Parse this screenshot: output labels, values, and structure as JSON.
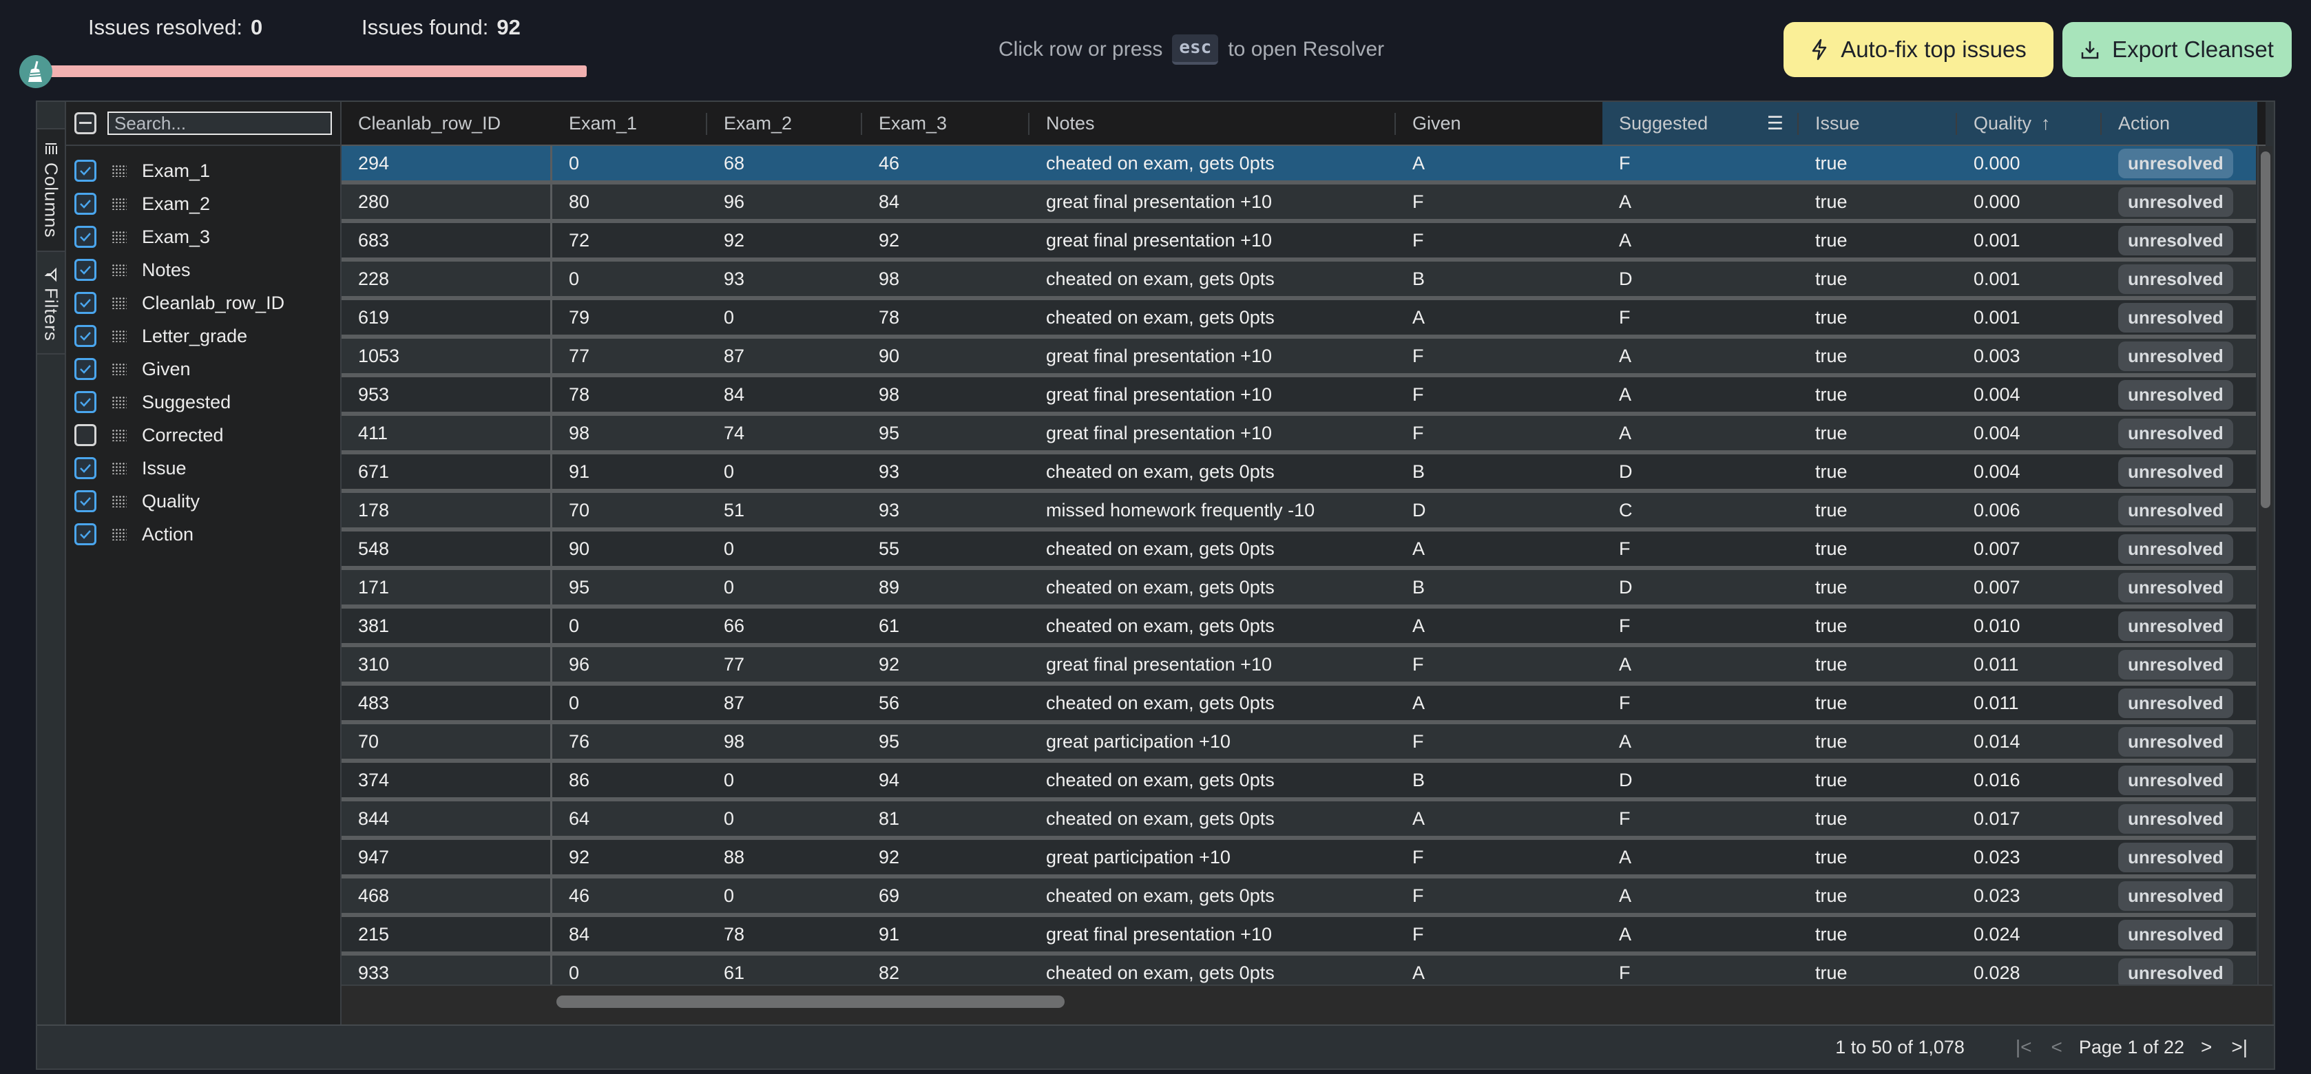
{
  "header": {
    "issues_resolved_label": "Issues resolved:",
    "issues_resolved_value": "0",
    "issues_found_label": "Issues found:",
    "issues_found_value": "92",
    "progress_fraction": 0.0,
    "hint_before": "Click row or press",
    "hint_key": "esc",
    "hint_after": "to open Resolver",
    "autofix_label": "Auto-fix top issues",
    "export_label": "Export Cleanset",
    "colors": {
      "autofix": "#faef97",
      "export": "#a8e4bb",
      "progress_bg": "#f2b1b1",
      "broom": "#4f9a93"
    }
  },
  "side_tabs": {
    "columns": "Columns",
    "filters": "Filters"
  },
  "column_panel": {
    "search_placeholder": "Search...",
    "columns": [
      {
        "name": "Exam_1",
        "checked": true
      },
      {
        "name": "Exam_2",
        "checked": true
      },
      {
        "name": "Exam_3",
        "checked": true
      },
      {
        "name": "Notes",
        "checked": true
      },
      {
        "name": "Cleanlab_row_ID",
        "checked": true
      },
      {
        "name": "Letter_grade",
        "checked": true
      },
      {
        "name": "Given",
        "checked": true
      },
      {
        "name": "Suggested",
        "checked": true
      },
      {
        "name": "Corrected",
        "checked": false
      },
      {
        "name": "Issue",
        "checked": true
      },
      {
        "name": "Quality",
        "checked": true
      },
      {
        "name": "Action",
        "checked": true
      }
    ]
  },
  "table": {
    "headers": [
      "Cleanlab_row_ID",
      "Exam_1",
      "Exam_2",
      "Exam_3",
      "Notes",
      "Given",
      "Suggested",
      "Issue",
      "Quality",
      "Action"
    ],
    "sort_indicator": "↑",
    "rows": [
      [
        "294",
        "0",
        "68",
        "46",
        "cheated on exam, gets 0pts",
        "A",
        "F",
        "true",
        "0.000",
        "unresolved"
      ],
      [
        "280",
        "80",
        "96",
        "84",
        "great final presentation +10",
        "F",
        "A",
        "true",
        "0.000",
        "unresolved"
      ],
      [
        "683",
        "72",
        "92",
        "92",
        "great final presentation +10",
        "F",
        "A",
        "true",
        "0.001",
        "unresolved"
      ],
      [
        "228",
        "0",
        "93",
        "98",
        "cheated on exam, gets 0pts",
        "B",
        "D",
        "true",
        "0.001",
        "unresolved"
      ],
      [
        "619",
        "79",
        "0",
        "78",
        "cheated on exam, gets 0pts",
        "A",
        "F",
        "true",
        "0.001",
        "unresolved"
      ],
      [
        "1053",
        "77",
        "87",
        "90",
        "great final presentation +10",
        "F",
        "A",
        "true",
        "0.003",
        "unresolved"
      ],
      [
        "953",
        "78",
        "84",
        "98",
        "great final presentation +10",
        "F",
        "A",
        "true",
        "0.004",
        "unresolved"
      ],
      [
        "411",
        "98",
        "74",
        "95",
        "great final presentation +10",
        "F",
        "A",
        "true",
        "0.004",
        "unresolved"
      ],
      [
        "671",
        "91",
        "0",
        "93",
        "cheated on exam, gets 0pts",
        "B",
        "D",
        "true",
        "0.004",
        "unresolved"
      ],
      [
        "178",
        "70",
        "51",
        "93",
        "missed homework frequently -10",
        "D",
        "C",
        "true",
        "0.006",
        "unresolved"
      ],
      [
        "548",
        "90",
        "0",
        "55",
        "cheated on exam, gets 0pts",
        "A",
        "F",
        "true",
        "0.007",
        "unresolved"
      ],
      [
        "171",
        "95",
        "0",
        "89",
        "cheated on exam, gets 0pts",
        "B",
        "D",
        "true",
        "0.007",
        "unresolved"
      ],
      [
        "381",
        "0",
        "66",
        "61",
        "cheated on exam, gets 0pts",
        "A",
        "F",
        "true",
        "0.010",
        "unresolved"
      ],
      [
        "310",
        "96",
        "77",
        "92",
        "great final presentation +10",
        "F",
        "A",
        "true",
        "0.011",
        "unresolved"
      ],
      [
        "483",
        "0",
        "87",
        "56",
        "cheated on exam, gets 0pts",
        "A",
        "F",
        "true",
        "0.011",
        "unresolved"
      ],
      [
        "70",
        "76",
        "98",
        "95",
        "great participation +10",
        "F",
        "A",
        "true",
        "0.014",
        "unresolved"
      ],
      [
        "374",
        "86",
        "0",
        "94",
        "cheated on exam, gets 0pts",
        "B",
        "D",
        "true",
        "0.016",
        "unresolved"
      ],
      [
        "844",
        "64",
        "0",
        "81",
        "cheated on exam, gets 0pts",
        "A",
        "F",
        "true",
        "0.017",
        "unresolved"
      ],
      [
        "947",
        "92",
        "88",
        "92",
        "great participation +10",
        "F",
        "A",
        "true",
        "0.023",
        "unresolved"
      ],
      [
        "468",
        "46",
        "0",
        "69",
        "cheated on exam, gets 0pts",
        "F",
        "A",
        "true",
        "0.023",
        "unresolved"
      ],
      [
        "215",
        "84",
        "78",
        "91",
        "great final presentation +10",
        "F",
        "A",
        "true",
        "0.024",
        "unresolved"
      ],
      [
        "933",
        "0",
        "61",
        "82",
        "cheated on exam, gets 0pts",
        "A",
        "F",
        "true",
        "0.028",
        "unresolved"
      ]
    ],
    "selected_row_index": 0
  },
  "footer": {
    "summary": "1 to 50 of 1,078",
    "page_text": "Page 1 of 22"
  }
}
